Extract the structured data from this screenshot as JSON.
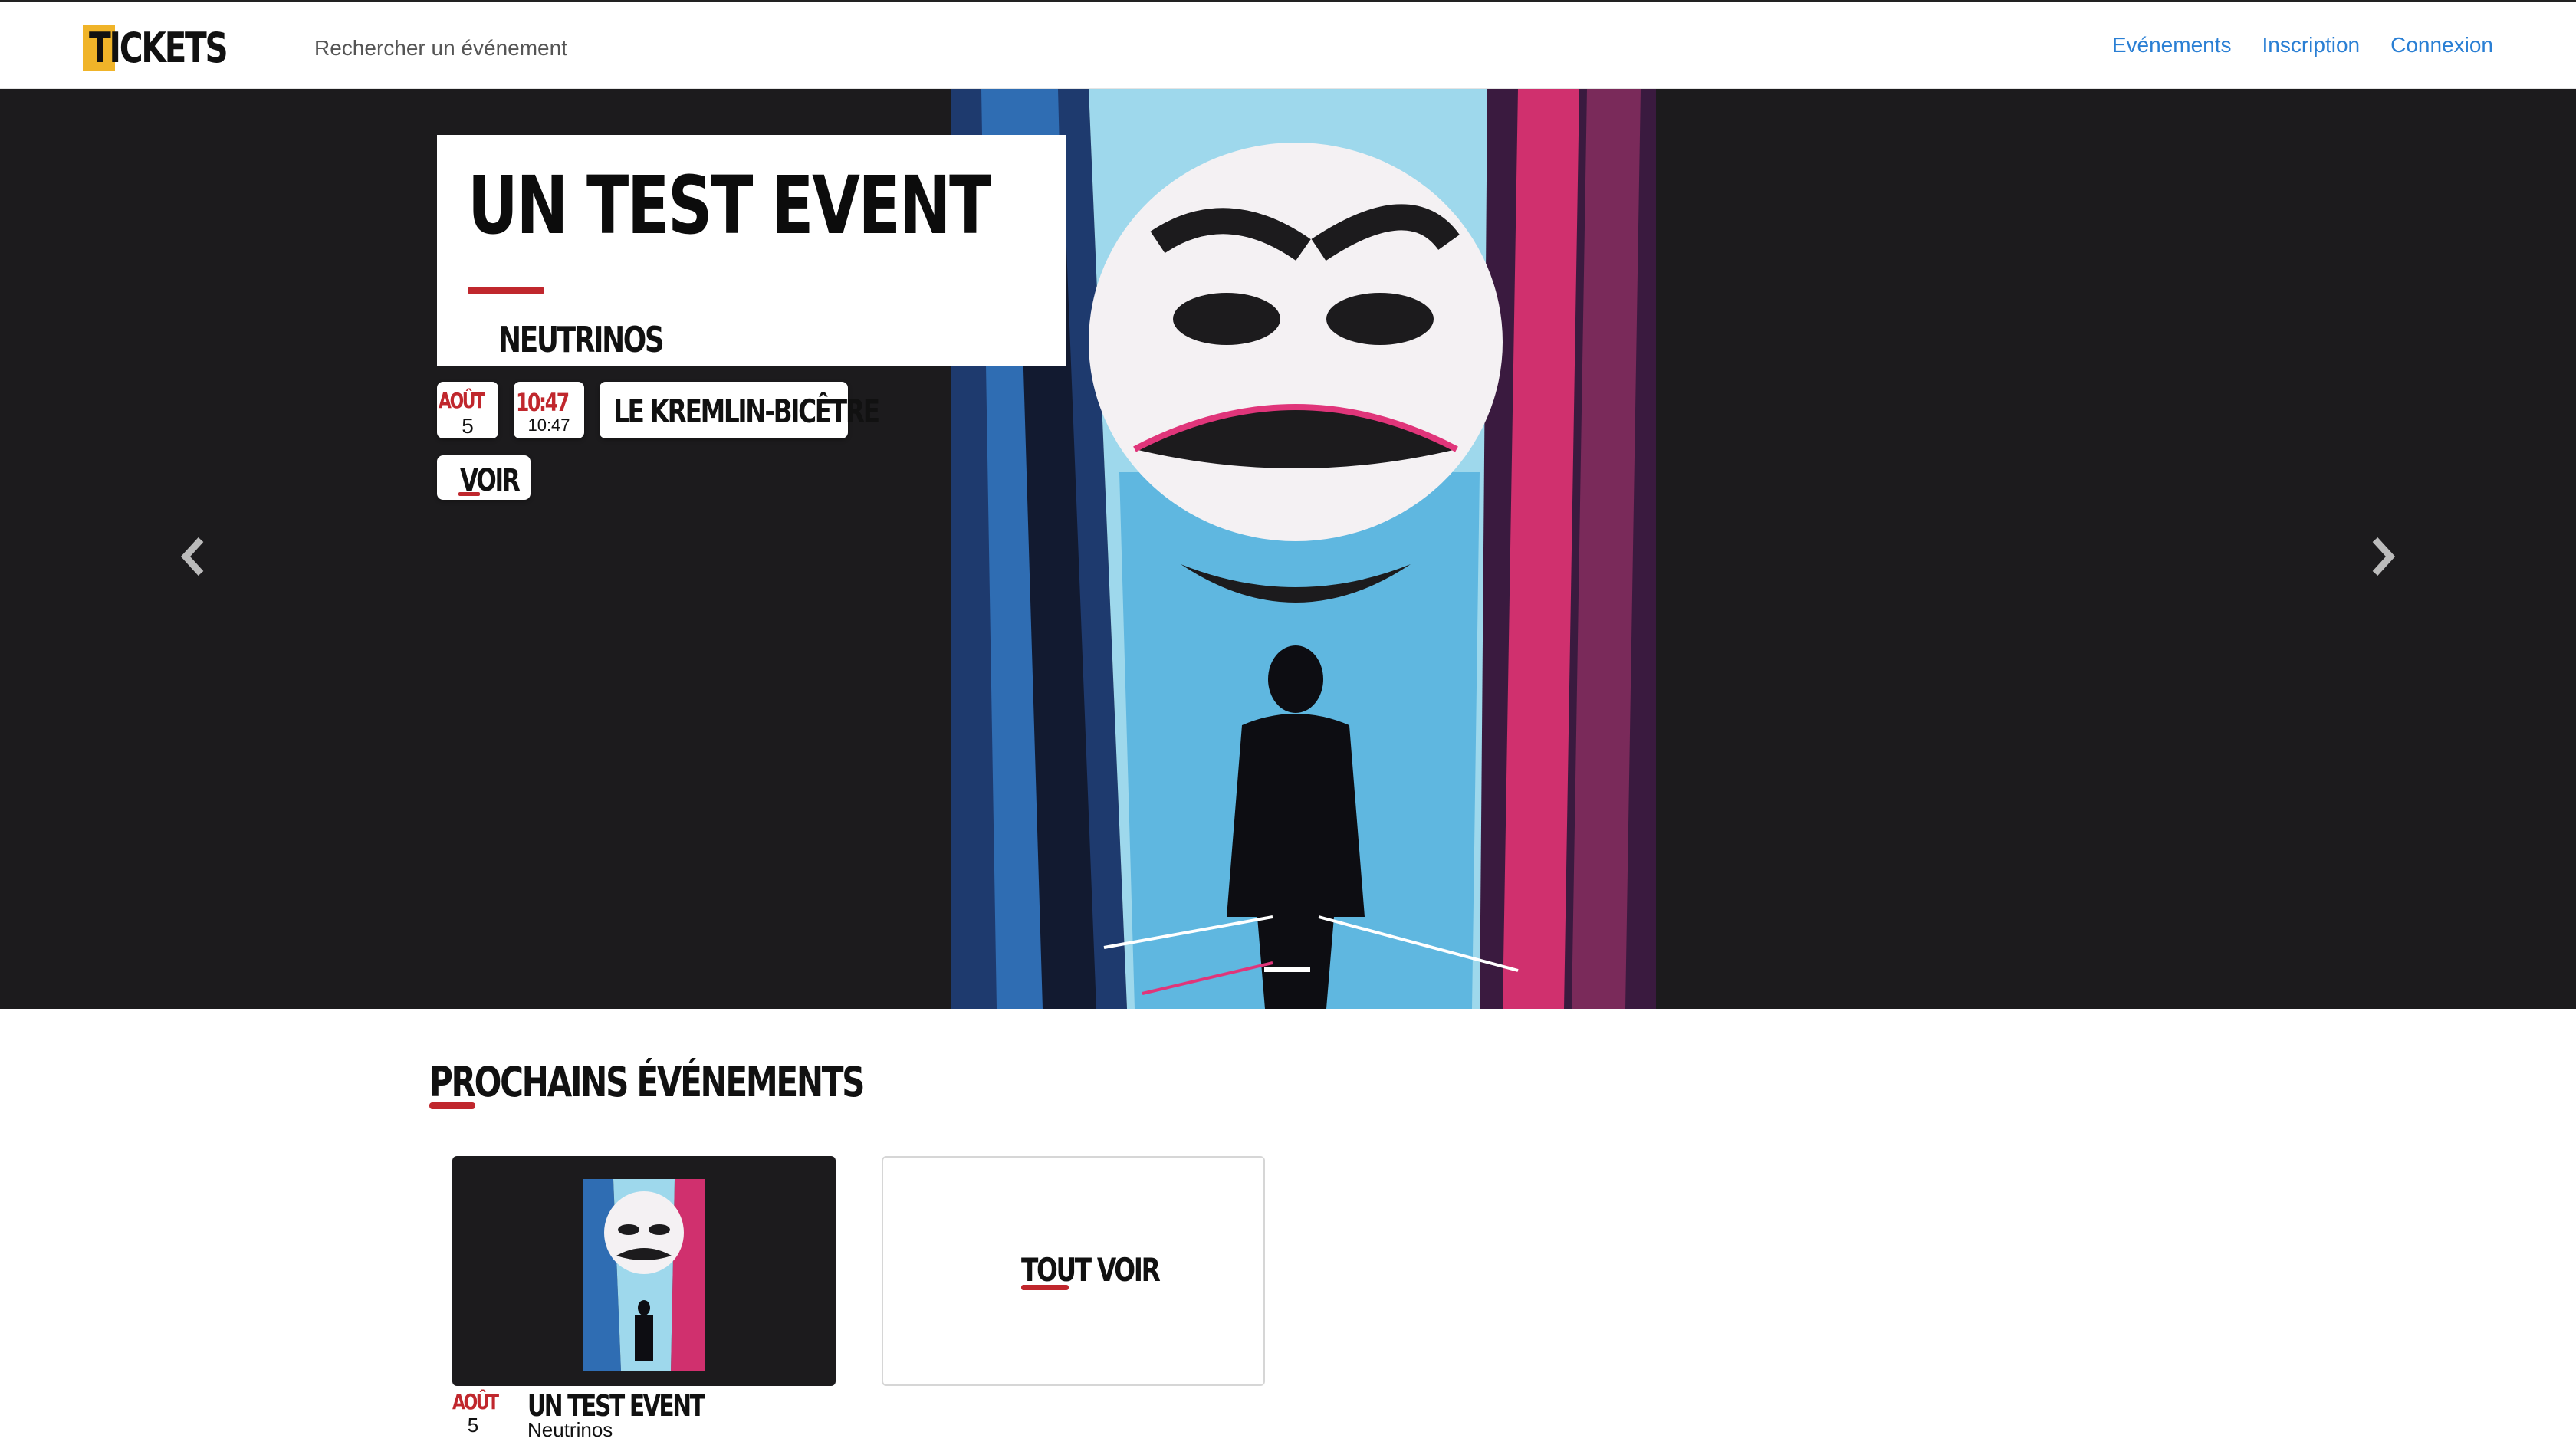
{
  "navbar": {
    "brand_first": "T",
    "brand_rest": "ICKETS",
    "search_placeholder": "Rechercher un événement",
    "links": [
      "Evénements",
      "Inscription",
      "Connexion"
    ]
  },
  "hero": {
    "title": "UN TEST EVENT",
    "organizer": "NEUTRINOS",
    "date_month": "AOÛT",
    "date_day": "5",
    "time_main": "10:47",
    "time_small": "10:47",
    "location": "LE KREMLIN-BICÊTRE",
    "cta_label": "VOIR",
    "prev_icon": "chevron-left-icon",
    "next_icon": "chevron-right-icon"
  },
  "upcoming": {
    "section_title": "PROCHAINS ÉVÉNEMENTS",
    "events": [
      {
        "month": "AOÛT",
        "day": "5",
        "title": "UN TEST EVENT",
        "organizer": "Neutrinos"
      }
    ],
    "see_all_label": "TOUT VOIR"
  },
  "colors": {
    "accent_red": "#c0272d",
    "brand_yellow": "#f0b429",
    "link_blue": "#2a7fd4",
    "hero_bg": "#1c1b1d"
  }
}
